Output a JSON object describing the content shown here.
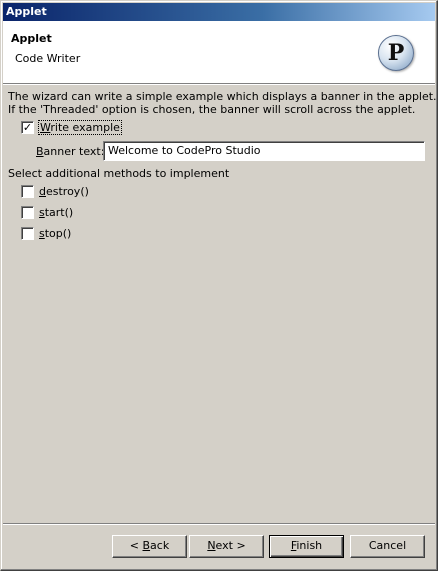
{
  "window": {
    "title": "Applet"
  },
  "banner": {
    "title": "Applet",
    "subtitle": "Code Writer",
    "logo_letter": "P",
    "logo_icon": "codepro-logo-icon"
  },
  "description": {
    "line1": "The wizard can write a simple example which displays a banner in the applet.",
    "line2": "If the 'Threaded' option is chosen, the banner will scroll across the applet."
  },
  "write_example": {
    "label_key": "W",
    "label_rest": "rite example",
    "checked": true
  },
  "banner_text": {
    "label_key": "B",
    "label_rest": "anner text:",
    "value": "Welcome to CodePro Studio"
  },
  "methods": {
    "heading": "Select additional methods to implement",
    "items": [
      {
        "key": "d",
        "rest": "estroy()",
        "checked": false
      },
      {
        "key": "s",
        "rest": "tart()",
        "checked": false
      },
      {
        "key": "s",
        "rest": "top()",
        "checked": false
      }
    ]
  },
  "buttons": {
    "back": {
      "pre": "< ",
      "key": "B",
      "rest": "ack"
    },
    "next": {
      "key": "N",
      "rest": "ext >"
    },
    "finish": {
      "key": "F",
      "rest": "inish"
    },
    "cancel": {
      "label": "Cancel"
    }
  }
}
